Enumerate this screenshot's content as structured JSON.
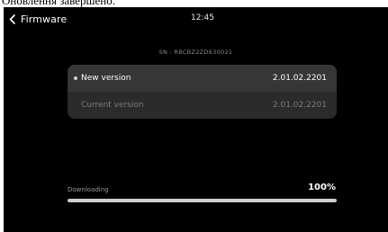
{
  "caption": "Оновлення завершено.",
  "header": {
    "back_label": "Firmware",
    "time": "12:45"
  },
  "device": {
    "serial": "SN : RBCBZ2ZD630021"
  },
  "versions": {
    "new_label": "New version",
    "new_value": "2.01.02.2201",
    "current_label": "Current version",
    "current_value": "2.01.02.2201"
  },
  "download": {
    "label": "Downloading",
    "percent_text": "100%",
    "progress_fraction": 1.0
  },
  "colors": {
    "background": "#000000",
    "card": "#2b2b2b",
    "highlight_row": "#363636",
    "progress_fill": "#cfcfcf",
    "progress_track": "#3a3a3a"
  },
  "icons": {
    "back": "chevron-left-icon",
    "bullet": "dot-icon"
  }
}
